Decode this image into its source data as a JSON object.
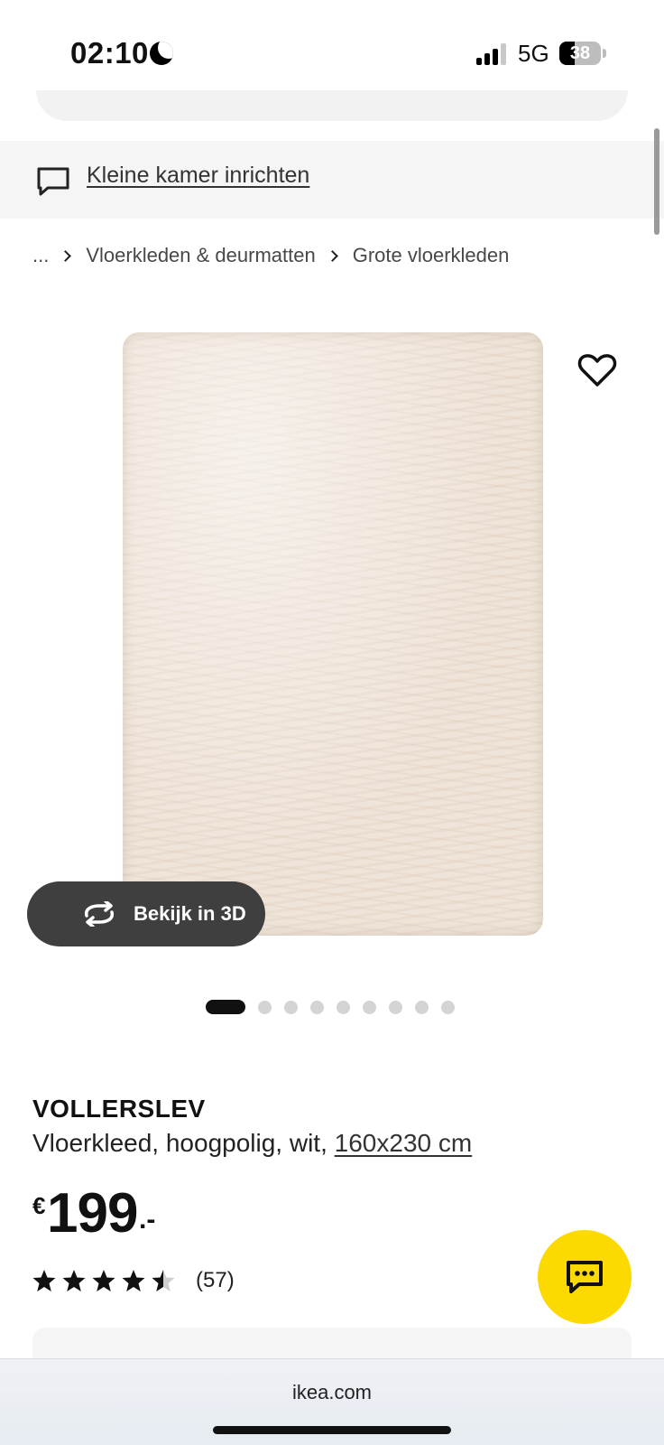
{
  "status_bar": {
    "time": "02:10",
    "network": "5G",
    "battery": "38",
    "battery_level": 0.38,
    "icons": [
      "moon-icon",
      "signal-icon",
      "battery-icon"
    ]
  },
  "promo": {
    "link_text": "Kleine kamer inrichten",
    "icon": "chat-bubble-icon"
  },
  "breadcrumb": {
    "items": [
      "...",
      "Vloerkleden & deurmatten",
      "Grote vloerkleden"
    ]
  },
  "gallery": {
    "view_3d_label": "Bekijk in 3D",
    "image_count": 9,
    "active_index": 0
  },
  "product": {
    "name": "VOLLERSLEV",
    "description": "Vloerkleed, hoogpolig, wit, ",
    "size_link": "160x230 cm",
    "price_currency": "€",
    "price_amount": "199",
    "price_suffix": ".-",
    "rating_value": 4.5,
    "rating_max": 5,
    "rating_count": "(57)"
  },
  "colors": {
    "accent_yellow": "#fcd900",
    "button_dark": "#3f3f3f"
  },
  "browser": {
    "url": "ikea.com"
  }
}
